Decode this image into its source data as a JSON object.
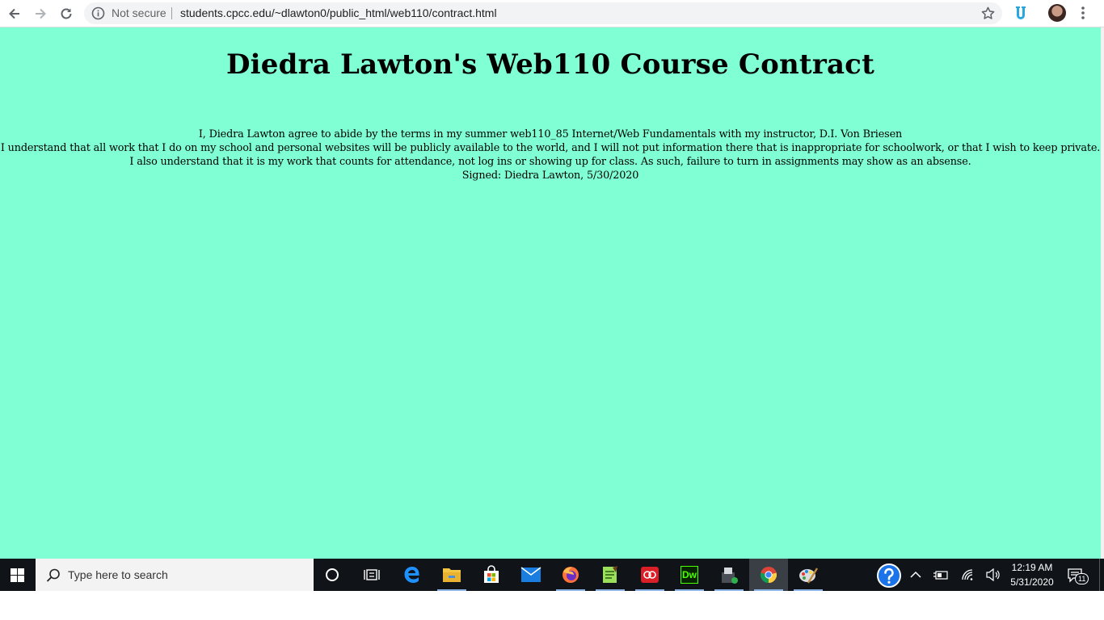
{
  "browser": {
    "security_label": "Not secure",
    "url": "students.cpcc.edu/~dlawton0/public_html/web110/contract.html",
    "icons": [
      "back-arrow-icon",
      "forward-arrow-icon",
      "reload-icon",
      "info-icon",
      "star-icon",
      "extension-icon",
      "profile-avatar",
      "menu-dots-icon"
    ]
  },
  "page": {
    "background_color": "#80ffd4",
    "title": "Diedra Lawton's Web110 Course Contract",
    "lines": [
      "I, Diedra Lawton agree to abide by the terms in my summer web110_85 Internet/Web Fundamentals with my instructor, D.I. Von Briesen",
      "I understand that all work that I do on my school and personal websites will be publicly available to the world, and I will not put information there that is inappropriate for schoolwork, or that I wish to keep private.",
      "I also understand that it is my work that counts for attendance, not log ins or showing up for class. As such, failure to turn in assignments may show as an absense.",
      "Signed: Diedra Lawton, 5/30/2020"
    ]
  },
  "taskbar": {
    "search_placeholder": "Type here to search",
    "apps": [
      "cortana-icon",
      "task-view-icon",
      "edge-icon",
      "file-explorer-icon",
      "store-icon",
      "mail-icon",
      "firefox-icon",
      "notepad-plus-icon",
      "adobe-cc-icon",
      "dreamweaver-icon",
      "snipping-icon",
      "chrome-icon",
      "paint-icon"
    ],
    "dreamweaver_label": "Dw",
    "time": "12:19 AM",
    "date": "5/31/2020",
    "notification_count": "11"
  }
}
